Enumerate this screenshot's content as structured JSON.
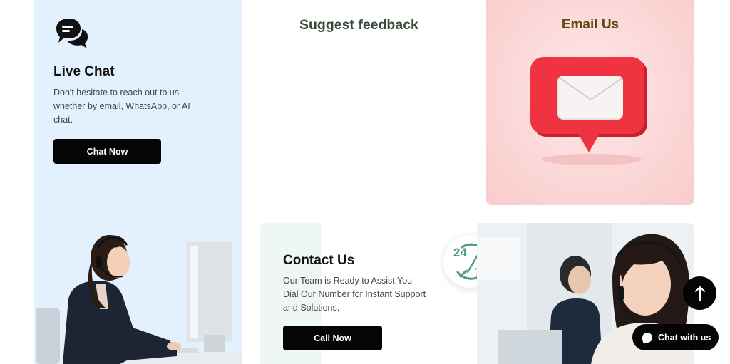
{
  "live_chat": {
    "title": "Live Chat",
    "description": "Don't hesitate to reach out to us - whether by email, WhatsApp, or AI chat.",
    "button_label": "Chat Now",
    "icon": "chat-bubbles-icon"
  },
  "feedback": {
    "title": "Suggest feedback"
  },
  "email": {
    "title": "Email Us",
    "icon": "envelope-icon"
  },
  "contact": {
    "title": "Contact Us",
    "description": "Our Team is Ready to Assist You - Dial Our Number for Instant Support and Solutions.",
    "button_label": "Call Now",
    "badge": "24/7"
  },
  "floating": {
    "scroll_top_icon": "arrow-up-icon",
    "chat_label": "Chat with us"
  },
  "colors": {
    "live_panel_bg": "#e3f1ff",
    "email_panel_bg": "#fbd3d3",
    "button_bg": "#050505",
    "mail_red": "#ef3340",
    "badge_teal": "#4c9a8a"
  }
}
